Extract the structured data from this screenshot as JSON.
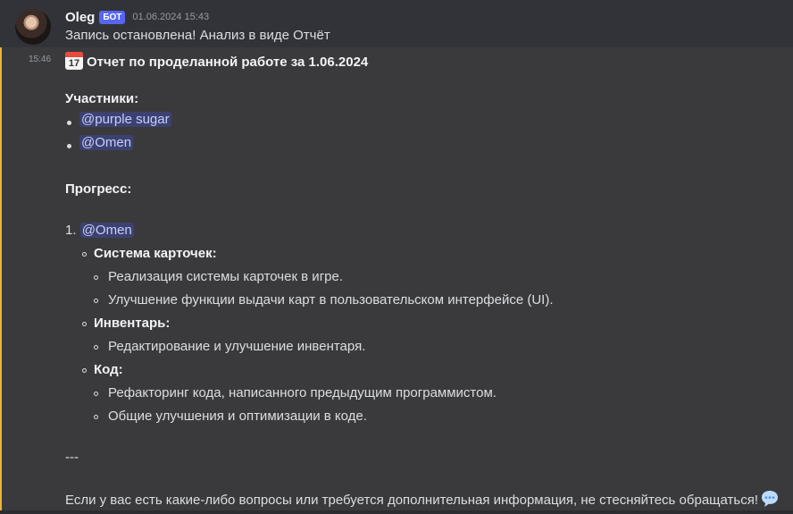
{
  "message": {
    "author": "Oleg",
    "bot_tag": "БОТ",
    "timestamp": "01.06.2024 15:43",
    "first_line": "Запись остановлена! Анализ в виде Отчёт"
  },
  "report": {
    "side_time": "15:46",
    "calendar_icon": "calendar-icon",
    "calendar_day": "17",
    "title": "Отчет по проделанной работе за 1.06.2024",
    "participants_heading": "Участники:",
    "participants": [
      "@purple sugar",
      "@Omen"
    ],
    "progress_heading": "Прогресс:",
    "progress_number": "1.",
    "progress_mention": "@Omen",
    "sections": [
      {
        "title": "Система карточек:",
        "items": [
          "Реализация системы карточек в игре.",
          "Улучшение функции выдачи карт в пользовательском интерфейсе (UI)."
        ]
      },
      {
        "title": "Инвентарь:",
        "items": [
          "Редактирование и улучшение инвентаря."
        ]
      },
      {
        "title": "Код:",
        "items": [
          "Рефакторинг кода, написанного предыдущим программистом.",
          "Общие улучшения и оптимизации в коде."
        ]
      }
    ],
    "separator": "---",
    "closing": "Если у вас есть какие-либо вопросы или требуется дополнительная информация, не стесняйтесь обращаться!",
    "closing_icon": "speech-bubble-icon"
  },
  "colors": {
    "highlight_bar": "#f0b232",
    "mention_bg": "#3c4270",
    "bot_tag": "#5865f2"
  }
}
